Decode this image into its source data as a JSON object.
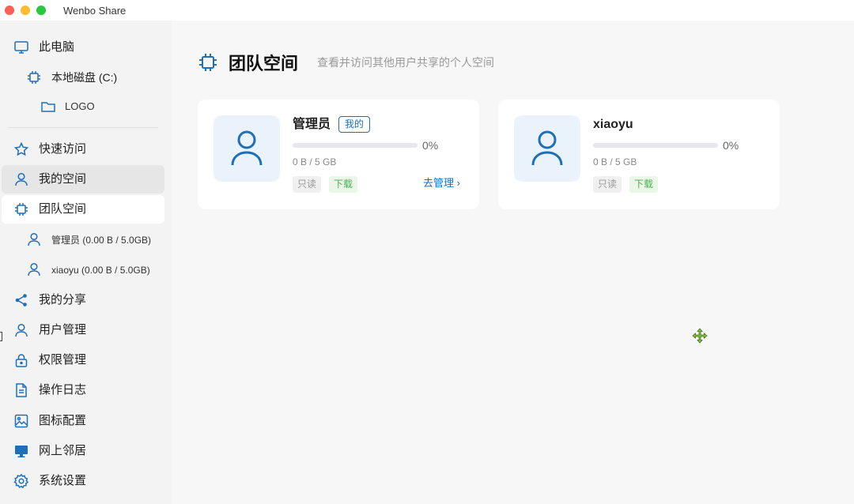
{
  "window": {
    "title": "Wenbo Share"
  },
  "sidebar": {
    "items": [
      {
        "label": "此电脑",
        "icon": "monitor-icon"
      },
      {
        "label": "本地磁盘 (C:)",
        "icon": "chip-icon"
      },
      {
        "label": "LOGO",
        "icon": "folder-icon"
      },
      {
        "label": "快速访问",
        "icon": "star-icon"
      },
      {
        "label": "我的空间",
        "icon": "user-icon"
      },
      {
        "label": "团队空间",
        "icon": "chip-icon"
      },
      {
        "label": "管理员 (0.00 B / 5.0GB)",
        "icon": "user-icon"
      },
      {
        "label": "xiaoyu (0.00 B / 5.0GB)",
        "icon": "user-icon"
      },
      {
        "label": "我的分享",
        "icon": "share-icon"
      },
      {
        "label": "用户管理",
        "icon": "user-icon"
      },
      {
        "label": "权限管理",
        "icon": "lock-icon"
      },
      {
        "label": "操作日志",
        "icon": "document-icon"
      },
      {
        "label": "图标配置",
        "icon": "image-icon"
      },
      {
        "label": "网上邻居",
        "icon": "network-monitor-icon"
      },
      {
        "label": "系统设置",
        "icon": "gear-icon"
      }
    ],
    "active": "团队空间"
  },
  "page": {
    "title": "团队空间",
    "subtitle": "查看并访问其他用户共享的个人空间"
  },
  "cards": [
    {
      "name": "管理员",
      "tag": "我的",
      "percent": "0%",
      "usage_fraction": 0,
      "usage": "0 B / 5 GB",
      "perm_read": "只读",
      "perm_download": "下载",
      "manage_label": "去管理 ›"
    },
    {
      "name": "xiaoyu",
      "percent": "0%",
      "usage_fraction": 0,
      "usage": "0 B / 5 GB",
      "perm_read": "只读",
      "perm_download": "下载"
    }
  ],
  "colors": {
    "accent": "#1e6fb8",
    "sidebar_bg": "#f3f3f3",
    "main_bg": "#f7f7f7",
    "download_green": "#4caf50"
  }
}
